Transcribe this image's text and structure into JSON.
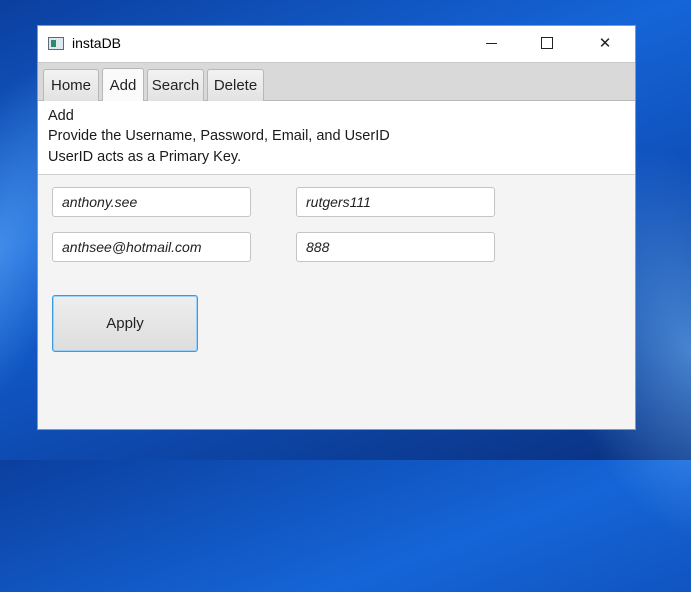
{
  "window": {
    "title": "instaDB",
    "controls": {
      "minimize_icon": "minimize-icon",
      "maximize_icon": "maximize-icon",
      "close_icon": "close-icon",
      "close_glyph": "✕"
    }
  },
  "tabs": [
    {
      "label": "Home",
      "selected": false
    },
    {
      "label": "Add",
      "selected": true
    },
    {
      "label": "Search",
      "selected": false
    },
    {
      "label": "Delete",
      "selected": false
    }
  ],
  "description": {
    "heading": "Add",
    "line1": "Provide the Username, Password, Email, and UserID",
    "line2": "UserID acts as a Primary Key."
  },
  "form": {
    "username": "anthony.see",
    "password": "rutgers111",
    "email": "anthsee@hotmail.com",
    "userid": "888",
    "apply_label": "Apply"
  },
  "colors": {
    "accent_focus": "#3c9be0",
    "desktop": "#1565d8"
  }
}
